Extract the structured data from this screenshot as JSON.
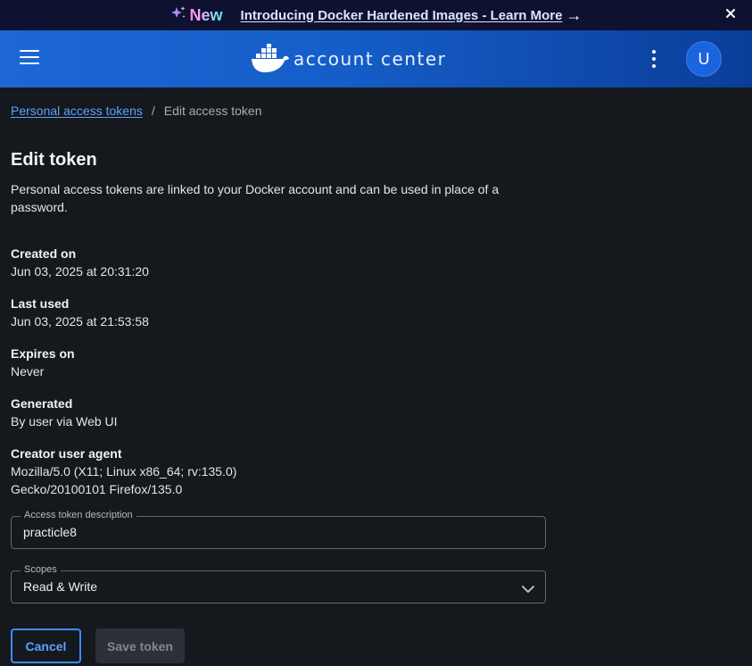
{
  "banner": {
    "new_label": "New",
    "link_text": "Introducing Docker Hardened Images - Learn More",
    "arrow": "→",
    "close": "✕"
  },
  "header": {
    "logo_text": "account center",
    "avatar_initial": "U"
  },
  "breadcrumb": {
    "parent": "Personal access tokens",
    "separator": "/",
    "current": "Edit access token"
  },
  "page": {
    "title": "Edit token",
    "description": "Personal access tokens are linked to your Docker account and can be used in place of a password."
  },
  "details": [
    {
      "label": "Created on",
      "value": "Jun 03, 2025 at 20:31:20"
    },
    {
      "label": "Last used",
      "value": "Jun 03, 2025 at 21:53:58"
    },
    {
      "label": "Expires on",
      "value": "Never"
    },
    {
      "label": "Generated",
      "value": "By user via Web UI"
    },
    {
      "label": "Creator user agent",
      "value": "Mozilla/5.0 (X11; Linux x86_64; rv:135.0)",
      "value2": "Gecko/20100101 Firefox/135.0"
    }
  ],
  "form": {
    "description_label": "Access token description",
    "description_value": "practicle8",
    "scopes_label": "Scopes",
    "scopes_value": "Read & Write"
  },
  "actions": {
    "cancel": "Cancel",
    "save": "Save token"
  },
  "colors": {
    "banner_bg": "#0e1130",
    "header_bg": "#1c66d6",
    "page_bg": "#15181d",
    "link": "#5aa2ff",
    "primary_outline": "#3d8bff"
  }
}
